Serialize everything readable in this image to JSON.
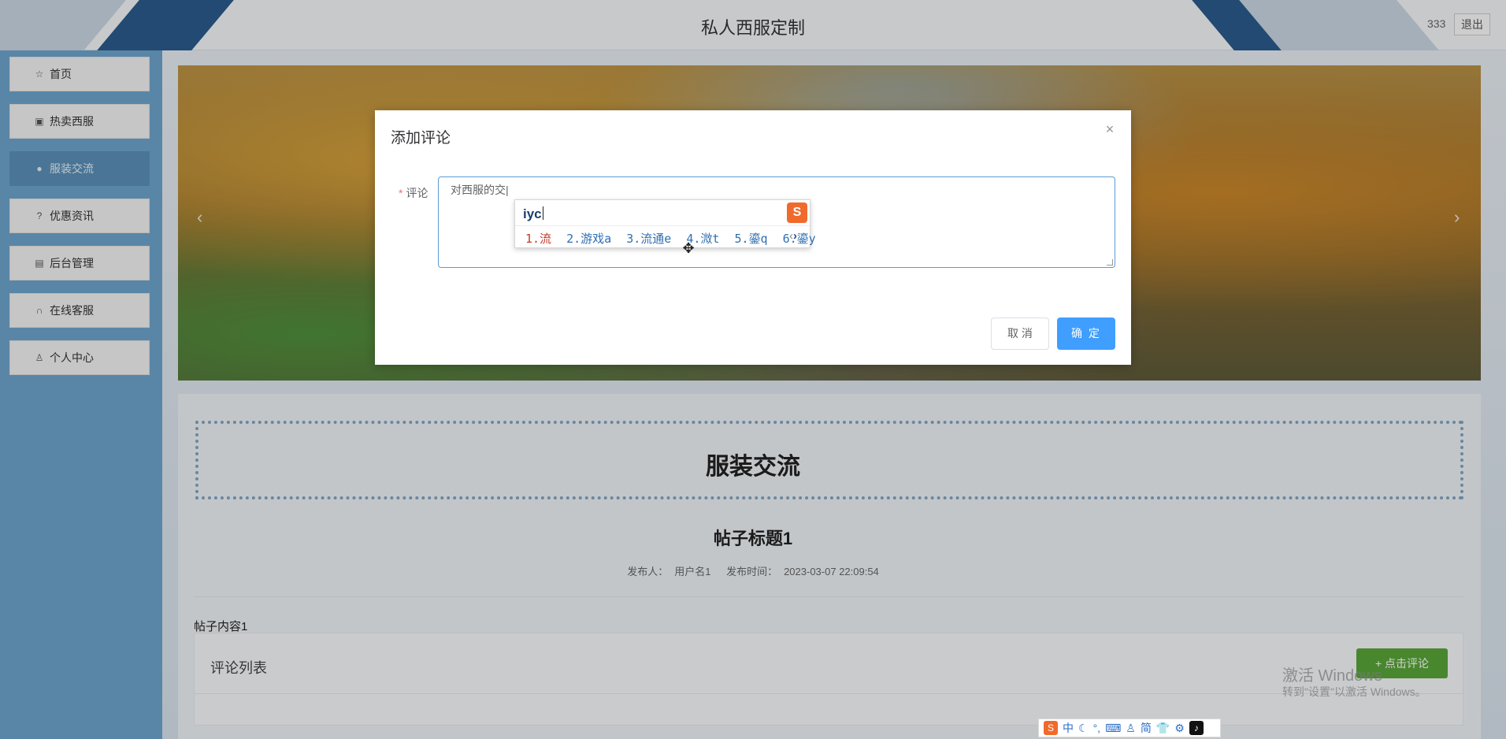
{
  "header": {
    "title": "私人西服定制",
    "username": "333",
    "logout_label": "退出"
  },
  "sidebar": {
    "items": [
      {
        "label": "首页",
        "icon": "star-icon",
        "glyph": "☆"
      },
      {
        "label": "热卖西服",
        "icon": "bag-icon",
        "glyph": "▣"
      },
      {
        "label": "服装交流",
        "icon": "info-icon",
        "glyph": "●"
      },
      {
        "label": "优惠资讯",
        "icon": "question-icon",
        "glyph": "?"
      },
      {
        "label": "后台管理",
        "icon": "briefcase-icon",
        "glyph": "▤"
      },
      {
        "label": "在线客服",
        "icon": "headset-icon",
        "glyph": "∩"
      },
      {
        "label": "个人中心",
        "icon": "user-icon",
        "glyph": "♙"
      }
    ],
    "active_index": 2
  },
  "banner": {
    "prev_glyph": "‹",
    "next_glyph": "›"
  },
  "main": {
    "section_title": "服装交流",
    "post_title": "帖子标题1",
    "meta": {
      "publisher_label": "发布人：",
      "publisher": "用户名1",
      "time_label": "发布时间：",
      "time": "2023-03-07 22:09:54"
    },
    "post_content": "帖子内容1",
    "comments_header": "评论列表",
    "comment_button": "+ 点击评论"
  },
  "dialog": {
    "title": "添加评论",
    "close_glyph": "×",
    "field_label": "评论",
    "textarea_value": "对西服的交|",
    "cancel_label": "取 消",
    "confirm_label": "确 定"
  },
  "ime": {
    "pinyin": "iyc",
    "logo_glyph": "S",
    "candidates": [
      "1.流",
      "2.游戏a",
      "3.流通e",
      "4.溦t",
      "5.鎏q",
      "6.鎏y"
    ],
    "prev": "‹",
    "next": "›"
  },
  "imebar": {
    "logo": "S",
    "items": [
      "中",
      "☾",
      "°,",
      "⌨",
      "♙",
      "简",
      "👕",
      "⚙"
    ],
    "tiktok": "♪"
  },
  "watermark": {
    "line1": "激活 Windows",
    "line2": "转到\"设置\"以激活 Windows。"
  },
  "colors": {
    "primary": "#409eff",
    "sidebar_bg": "#6da4cc",
    "header_stripe": "#2a5b8c",
    "success": "#5aa53a",
    "required": "#f56c6c"
  }
}
